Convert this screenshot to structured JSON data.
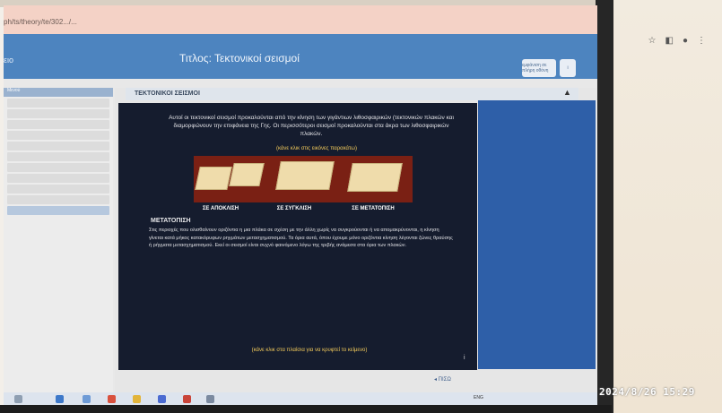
{
  "browser": {
    "url": "ph/ts/theory/te/302.../..."
  },
  "app": {
    "left_label": "ειο",
    "title": "Τιτλος: Τεκτονικοί σεισμοί",
    "header_button_a": "εμφάνιση σε πλήρη οθόνη",
    "header_button_b": "i"
  },
  "sidebar": {
    "header": "Μενού"
  },
  "slide": {
    "topic": "ΤΕΚΤΟΝΙΚΟΙ ΣΕΙΣΜΟΙ",
    "intro": "Αυτοί οι τεκτονικοί σεισμοί προκαλούνται από την κίνηση των γιγάντιων λιθοσφαιρικών (τεκτονικών πλακών και διαμορφώνουν την επιφάνεια της Γης. Οι περισσότεροι σεισμοί προκαλούνται στα άκρα των λιθοσφαιρικών πλακών.",
    "hint_top": "(κάνε κλικ στις εικόνες παρακάτω)",
    "plate_labels": [
      "ΣΕ ΑΠΟΚΛΙΣΗ",
      "ΣΕ ΣΥΓΚΛΙΣΗ",
      "ΣΕ ΜΕΤΑΤΟΠΙΣΗ"
    ],
    "section_title": "ΜΕΤΑΤΟΠΙΣΗ",
    "body": "Στις περιοχές που ολισθαίνουν οριζόντια η μια πλάκα σε σχέση με την άλλη χωρίς να συγκρούονται ή να απομακρύνονται, η κίνηση γίνεται κατά μήκος κατακόρυφων ρηγμάτων μετασχηματισμού. Τα όρια αυτά, όπου έχουμε μόνο οριζόντια κίνηση λέγονται ζώνες θραύσης ή ρήγματα μετασχηματισμού. Εκεί οι σεισμοί είναι συχνό φαινόμενο λόγω της τριβής ανάμεσα στα όρια των πλακών.",
    "hint_bottom": "(κάνε κλικ στα πλαίσια για να κρυφτεί το κείμενο)",
    "info": "i",
    "back": "◂ ΠΙΣΩ"
  },
  "taskbar": {
    "tray_text": "ENG"
  },
  "photo_stamp": "2024/8/26 15:29",
  "colors": {
    "header_blue": "#4d84bf",
    "slide_bg": "#151c2e",
    "plates_panel": "#7a2014",
    "hint_yellow": "#f1c95a"
  }
}
